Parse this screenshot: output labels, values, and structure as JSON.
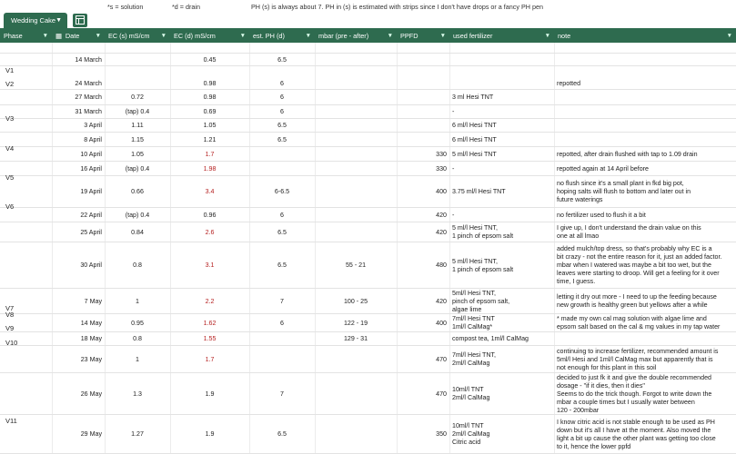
{
  "top_notes": {
    "solution": "*s = solution",
    "drain": "*d = drain",
    "ph_note": "PH (s) is always about 7. PH in (s) is estimated with strips since I don't have drops or a fancy PH pen"
  },
  "tab": {
    "label": "Wedding Cake"
  },
  "columns": [
    {
      "label": "Phase"
    },
    {
      "label": "Date"
    },
    {
      "label": "EC (s) mS/cm"
    },
    {
      "label": "EC (d) mS/cm"
    },
    {
      "label": "est. PH (d)"
    },
    {
      "label": "mbar (pre - after)"
    },
    {
      "label": "PPFD"
    },
    {
      "label": "used fertilizer"
    },
    {
      "label": "note"
    }
  ],
  "phases": [
    "V1",
    "V2",
    "V3",
    "V4",
    "V5",
    "V6",
    "V7",
    "V8",
    "V9",
    "V10",
    "V11"
  ],
  "rows": [
    {
      "date": "14 March",
      "ec_s": "",
      "ec_d": "0.45",
      "ec_d_red": false,
      "ph": "6.5",
      "mbar": "",
      "ppfd": "",
      "fert": "",
      "note": ""
    },
    {
      "date": "24 March",
      "ec_s": "",
      "ec_d": "0.98",
      "ec_d_red": false,
      "ph": "6",
      "mbar": "",
      "ppfd": "",
      "fert": "",
      "note": "repotted"
    },
    {
      "date": "27 March",
      "ec_s": "0.72",
      "ec_d": "0.98",
      "ec_d_red": false,
      "ph": "6",
      "mbar": "",
      "ppfd": "",
      "fert": "3 ml Hesi TNT",
      "note": ""
    },
    {
      "date": "31 March",
      "ec_s": "(tap) 0.4",
      "ec_d": "0.69",
      "ec_d_red": false,
      "ph": "6",
      "mbar": "",
      "ppfd": "",
      "fert": "-",
      "note": ""
    },
    {
      "date": "3 April",
      "ec_s": "1.11",
      "ec_d": "1.05",
      "ec_d_red": false,
      "ph": "6.5",
      "mbar": "",
      "ppfd": "",
      "fert": "6 ml/l Hesi TNT",
      "note": ""
    },
    {
      "date": "8 April",
      "ec_s": "1.15",
      "ec_d": "1.21",
      "ec_d_red": false,
      "ph": "6.5",
      "mbar": "",
      "ppfd": "",
      "fert": "6 ml/l Hesi TNT",
      "note": ""
    },
    {
      "date": "10 April",
      "ec_s": "1.05",
      "ec_d": "1.7",
      "ec_d_red": true,
      "ph": "",
      "mbar": "",
      "ppfd": "330",
      "fert": "5 ml/l Hesi TNT",
      "note": "repotted, after drain flushed with tap to 1.09 drain"
    },
    {
      "date": "16 April",
      "ec_s": "(tap) 0.4",
      "ec_d": "1.98",
      "ec_d_red": true,
      "ph": "",
      "mbar": "",
      "ppfd": "330",
      "fert": "-",
      "note": "repotted again at 14 April before"
    },
    {
      "date": "19 April",
      "ec_s": "0.66",
      "ec_d": "3.4",
      "ec_d_red": true,
      "ph": "6-6.5",
      "mbar": "",
      "ppfd": "400",
      "fert": "3.75 ml/l Hesi TNT",
      "note": "no flush since it's a small plant in fkd big pot,\nhoping salts will flush to bottom and later out in\nfuture waterings"
    },
    {
      "date": "22 April",
      "ec_s": "(tap) 0.4",
      "ec_d": "0.96",
      "ec_d_red": false,
      "ph": "6",
      "mbar": "",
      "ppfd": "420",
      "fert": "-",
      "note": "no fertilizer used to flush it a bit"
    },
    {
      "date": "25 April",
      "ec_s": "0.84",
      "ec_d": "2.6",
      "ec_d_red": true,
      "ph": "6.5",
      "mbar": "",
      "ppfd": "420",
      "fert": "5 ml/l Hesi TNT,\n1 pinch of epsom salt",
      "note": "I give up, I don't understand the drain value on this\none at all lmao"
    },
    {
      "date": "30 April",
      "ec_s": "0.8",
      "ec_d": "3.1",
      "ec_d_red": true,
      "ph": "6.5",
      "mbar": "55 - 21",
      "ppfd": "480",
      "fert": "5 ml/l Hesi TNT,\n1 pinch of epsom salt",
      "note": "added mulch/top dress, so that's probably why EC is a\nbit crazy - not the entire reason for it, just an added factor.\nmbar when I watered was maybe a bit too wet, but the\nleaves were starting to droop. Will get a feeling for it over\ntime, I guess."
    },
    {
      "date": "7 May",
      "ec_s": "1",
      "ec_d": "2.2",
      "ec_d_red": true,
      "ph": "7",
      "mbar": "100 - 25",
      "ppfd": "420",
      "fert": "5ml/l Hesi TNT,\npinch of epsom salt,\nalgae lime",
      "note": "letting it dry out more - I need to up the feeding because\nnew growth is healthy green but yellows after a while"
    },
    {
      "date": "14 May",
      "ec_s": "0.95",
      "ec_d": "1.62",
      "ec_d_red": true,
      "ph": "6",
      "mbar": "122 - 19",
      "ppfd": "400",
      "fert": "7ml/l Hesi TNT\n1ml/l CalMag*",
      "note": "* made my own cal mag solution with algae lime and\nepsom salt based on the cal & mg values in my tap water"
    },
    {
      "date": "18 May",
      "ec_s": "0.8",
      "ec_d": "1.55",
      "ec_d_red": true,
      "ph": "",
      "mbar": "129 - 31",
      "ppfd": "",
      "fert": "compost tea, 1ml/l CalMag",
      "note": ""
    },
    {
      "date": "23 May",
      "ec_s": "1",
      "ec_d": "1.7",
      "ec_d_red": true,
      "ph": "",
      "mbar": "",
      "ppfd": "470",
      "fert": "7ml/l Hesi TNT,\n2ml/l CalMag",
      "note": "continuing to increase fertilizer, recommended amount is\n5ml/l Hesi and 1ml/l CalMag max but apparently that is\nnot enough for this plant in this soil"
    },
    {
      "date": "26 May",
      "ec_s": "1.3",
      "ec_d": "1.9",
      "ec_d_red": false,
      "ph": "7",
      "mbar": "",
      "ppfd": "470",
      "fert": "10ml/l TNT\n2ml/l CalMag",
      "note": "decided to just fk it and give the double recommended\ndosage - \"if it dies, then it dies\"\nSeems to do the trick though. Forgot to write down the\nmbar a couple times but I usually water between\n120 - 200mbar"
    },
    {
      "date": "29 May",
      "ec_s": "1.27",
      "ec_d": "1.9",
      "ec_d_red": false,
      "ph": "6.5",
      "mbar": "",
      "ppfd": "350",
      "fert": "10ml/l TNT\n2ml/l CalMag\nCitric acid",
      "note": "I know citric acid is not stable enough to be used as PH\ndown but it's all I have at the moment. Also moved the\nlight a bit up cause the other plant was getting too close\nto it, hence the lower ppfd"
    }
  ]
}
